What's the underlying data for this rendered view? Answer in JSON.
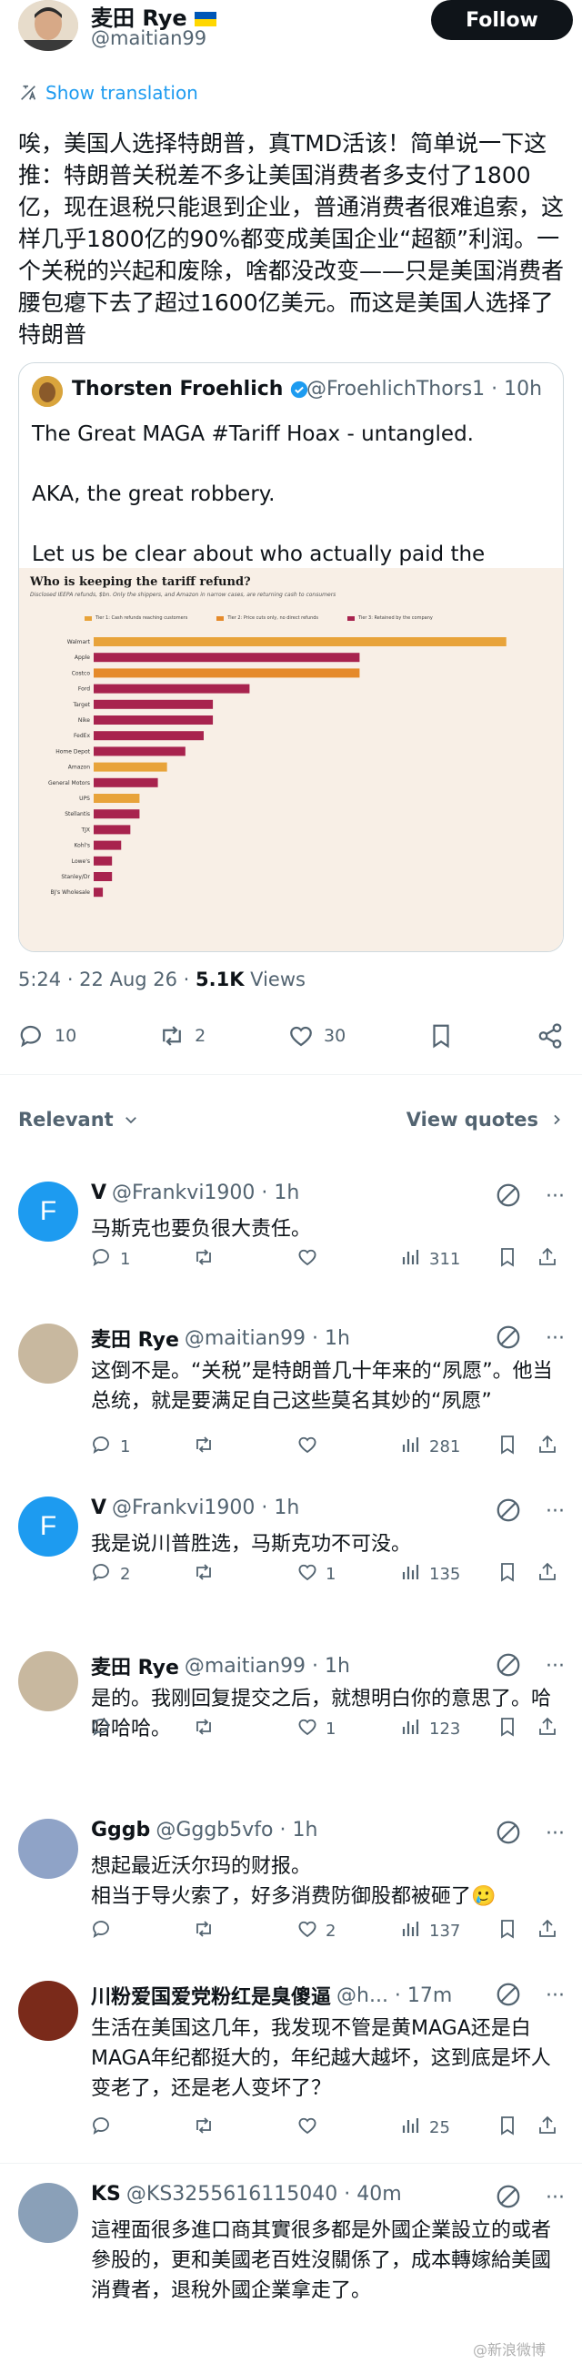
{
  "author": {
    "name": "麦田 Rye",
    "handle": "@maitian99",
    "follow_label": "Follow"
  },
  "translate_label": "Show translation",
  "post_text": "唉，美国人选择特朗普，真TMD活该！简单说一下这推：特朗普关税差不多让美国消费者多支付了1800亿，现在退税只能退到企业，普通消费者很难追索，这样几乎1800亿的90%都变成美国企业“超额”利润。一个关税的兴起和废除，啥都没改变——只是美国消费者腰包瘪下去了超过1600亿美元。而这是美国人选择了特朗普",
  "quote": {
    "name": "Thorsten Froehlich",
    "handle_time": "@FroehlichThors1 · 10h",
    "text": "The Great MAGA #Tariff Hoax - untangled.\n\nAKA, the great robbery.\n\nLet us be clear about who actually paid the tariff...",
    "chart_title": "Who is keeping the tariff refund?",
    "chart_subtitle": "Disclosed IEEPA refunds, $bn. Only the shippers, and Amazon in narrow cases, are returning cash to consumers",
    "legend": [
      {
        "label": "Tier 1: Cash refunds reaching customers",
        "color": "#e8a33a"
      },
      {
        "label": "Tier 2: Price cuts only, no direct refunds",
        "color": "#e58a2b"
      },
      {
        "label": "Tier 3: Retained by the company",
        "color": "#a8234e"
      }
    ]
  },
  "chart_data": {
    "type": "bar",
    "title": "Who is keeping the tariff refund?",
    "categories": [
      "Walmart",
      "Apple",
      "Costco",
      "Ford",
      "Target",
      "Nike",
      "FedEx",
      "Home Depot",
      "Amazon",
      "General Motors",
      "UPS",
      "Stellantis",
      "TJX",
      "Kohl's",
      "Lowe's",
      "Stanley/Dr",
      "BJ's Wholesale"
    ],
    "values": [
      4.5,
      2.9,
      2.9,
      1.7,
      1.3,
      1.3,
      1.2,
      1.0,
      0.8,
      0.7,
      0.5,
      0.5,
      0.4,
      0.3,
      0.2,
      0.2,
      0.1
    ],
    "colors": [
      "#e8a33a",
      "#a8234e",
      "#e58a2b",
      "#a8234e",
      "#a8234e",
      "#a8234e",
      "#a8234e",
      "#a8234e",
      "#e8a33a",
      "#a8234e",
      "#e8a33a",
      "#a8234e",
      "#a8234e",
      "#a8234e",
      "#a8234e",
      "#a8234e",
      "#a8234e"
    ],
    "xlim": [
      0,
      4.8
    ]
  },
  "meta": {
    "time": "5:24 · 22 Aug 26 · ",
    "views_count": "5.1K",
    "views_label": " Views"
  },
  "actions": {
    "replies": "10",
    "reposts": "2",
    "likes": "30"
  },
  "relevant_label": "Relevant",
  "view_quotes_label": "View quotes",
  "replies": [
    {
      "name": "V",
      "handle": "@Frankvi1900 · 1h",
      "text": "马斯克也要负很大责任。",
      "reply": "1",
      "repost": "",
      "like": "",
      "views": "311",
      "avatar": "F",
      "avatar_color": "#1d9bf0"
    },
    {
      "name": "麦田 Rye",
      "handle": "@maitian99 · 1h",
      "text": "这倒不是。“关税”是特朗普几十年来的“夙愿”。他当总统，就是要满足自己这些莫名其妙的“夙愿”",
      "reply": "1",
      "repost": "",
      "like": "",
      "views": "281",
      "avatar": "",
      "avatar_color": "#c8b89f"
    },
    {
      "name": "V",
      "handle": "@Frankvi1900 · 1h",
      "text": "我是说川普胜选，马斯克功不可没。",
      "reply": "2",
      "repost": "",
      "like": "1",
      "views": "135",
      "avatar": "F",
      "avatar_color": "#1d9bf0"
    },
    {
      "name": "麦田 Rye",
      "handle": "@maitian99 · 1h",
      "text": "是的。我刚回复提交之后，就想明白你的意思了。哈哈哈哈。",
      "reply": "",
      "repost": "",
      "like": "1",
      "views": "123",
      "avatar": "",
      "avatar_color": "#c8b89f"
    },
    {
      "name": "Gggb",
      "handle": "@Gggb5vfo · 1h",
      "text": "想起最近沃尔玛的财报。\n相当于导火索了，好多消费防御股都被砸了🥲",
      "reply": "",
      "repost": "",
      "like": "2",
      "views": "137",
      "avatar": "",
      "avatar_color": "#8fa3c7"
    },
    {
      "name": "川粉爱国爱党粉红是臭傻逼",
      "handle": "@h... · 17m",
      "text": "生活在美国这几年，我发现不管是黄MAGA还是白MAGA年纪都挺大的，年纪越大越坏，这到底是坏人变老了，还是老人变坏了？",
      "reply": "",
      "repost": "",
      "like": "",
      "views": "25",
      "avatar": "",
      "avatar_color": "#7a2a1a"
    },
    {
      "name": "KS",
      "handle": "@KS3255616115040 · 40m",
      "text": "這裡面很多進口商其實很多都是外國企業設立的或者參股的，更和美國老百姓沒關係了，成本轉嫁給美國消費者，退稅外國企業拿走了。",
      "reply": "",
      "repost": "",
      "like": "",
      "views": "",
      "avatar": "",
      "avatar_color": "#8aa0b8"
    }
  ],
  "watermark": "@新浪微博"
}
